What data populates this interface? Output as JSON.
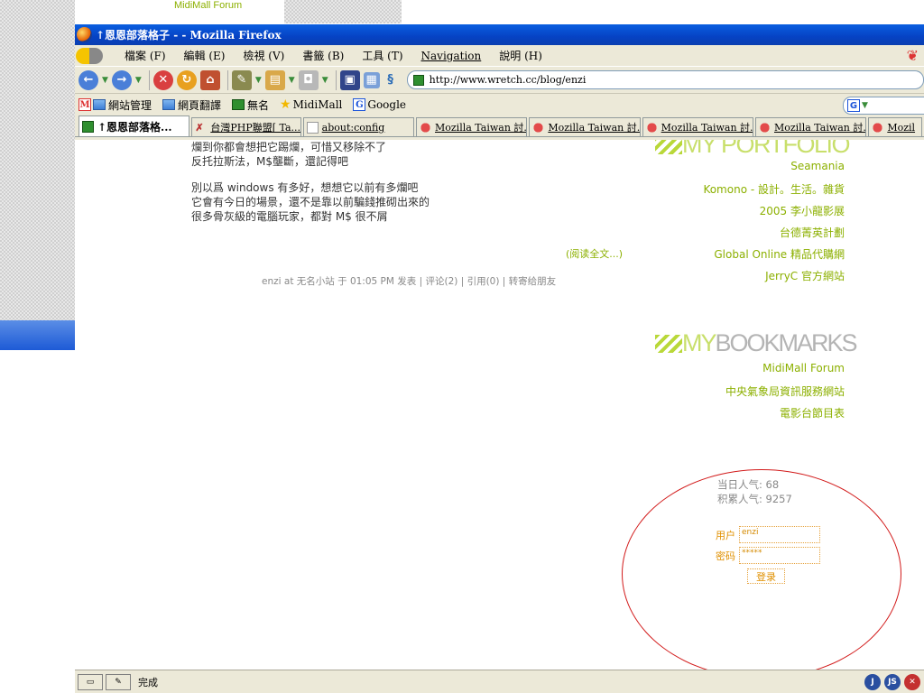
{
  "desktop": {
    "behind_link": "MidiMall Forum"
  },
  "window": {
    "title": "↑恩恩部落格子 - - Mozilla Firefox"
  },
  "menu": {
    "items": [
      "檔案 (F)",
      "編輯 (E)",
      "檢視 (V)",
      "書籤 (B)",
      "工具 (T)",
      "Navigation",
      "說明 (H)"
    ]
  },
  "nav": {
    "url": "http://www.wretch.cc/blog/enzi"
  },
  "bookmarks": {
    "items": [
      "網站管理",
      "網頁翻譯",
      "無名",
      "MidiMall",
      "Google"
    ]
  },
  "tabs": [
    {
      "label": "↑恩恩部落格...",
      "active": true
    },
    {
      "label": "台灣PHP聯盟[ Ta..."
    },
    {
      "label": "about:config"
    },
    {
      "label": "Mozilla Taiwan 討..."
    },
    {
      "label": "Mozilla Taiwan 討..."
    },
    {
      "label": "Mozilla Taiwan 討..."
    },
    {
      "label": "Mozilla Taiwan 討..."
    },
    {
      "label": "Mozil"
    }
  ],
  "post": {
    "lines": [
      "爛到你都會想把它踢爛，可惜又移除不了",
      "反托拉斯法，M$壟斷，還記得吧",
      "",
      "別以爲 windows 有多好，想想它以前有多爛吧",
      "它會有今日的場景，還不是靠以前騙錢推砌出來的",
      "很多骨灰級的電腦玩家，都對 M$ 很不屑"
    ],
    "read_more": "(阅读全文...)",
    "meta": "enzi at 无名小站 于 01:05 PM 发表 | 评论(2) | 引用(0) | 转寄给朋友"
  },
  "sidebar": {
    "portfolio_title": "MY PORTFOLIO",
    "portfolio_links": [
      "Seamania",
      "Komono - 設計。生活。雜貨",
      "2005 李小龍影展",
      "台德菁英計劃",
      "Global Online 精品代購網",
      "JerryC 官方網站"
    ],
    "bookmarks_title_my": "MY",
    "bookmarks_title_rest": "BOOKMARKS",
    "bookmark_links": [
      "MidiMall Forum",
      "中央氣象局資訊服務網站",
      "電影台節目表"
    ]
  },
  "stats": {
    "today": "当日人气: 68",
    "total": "积累人气: 9257"
  },
  "login": {
    "user_label": "用户",
    "user_value": "enzi",
    "pass_label": "密码",
    "pass_value": "*****",
    "submit": "登录"
  },
  "status": {
    "text": "完成"
  },
  "colors": {
    "accent_green": "#8cb000",
    "annotation_red": "#d21a1a",
    "login_orange": "#e09000"
  }
}
